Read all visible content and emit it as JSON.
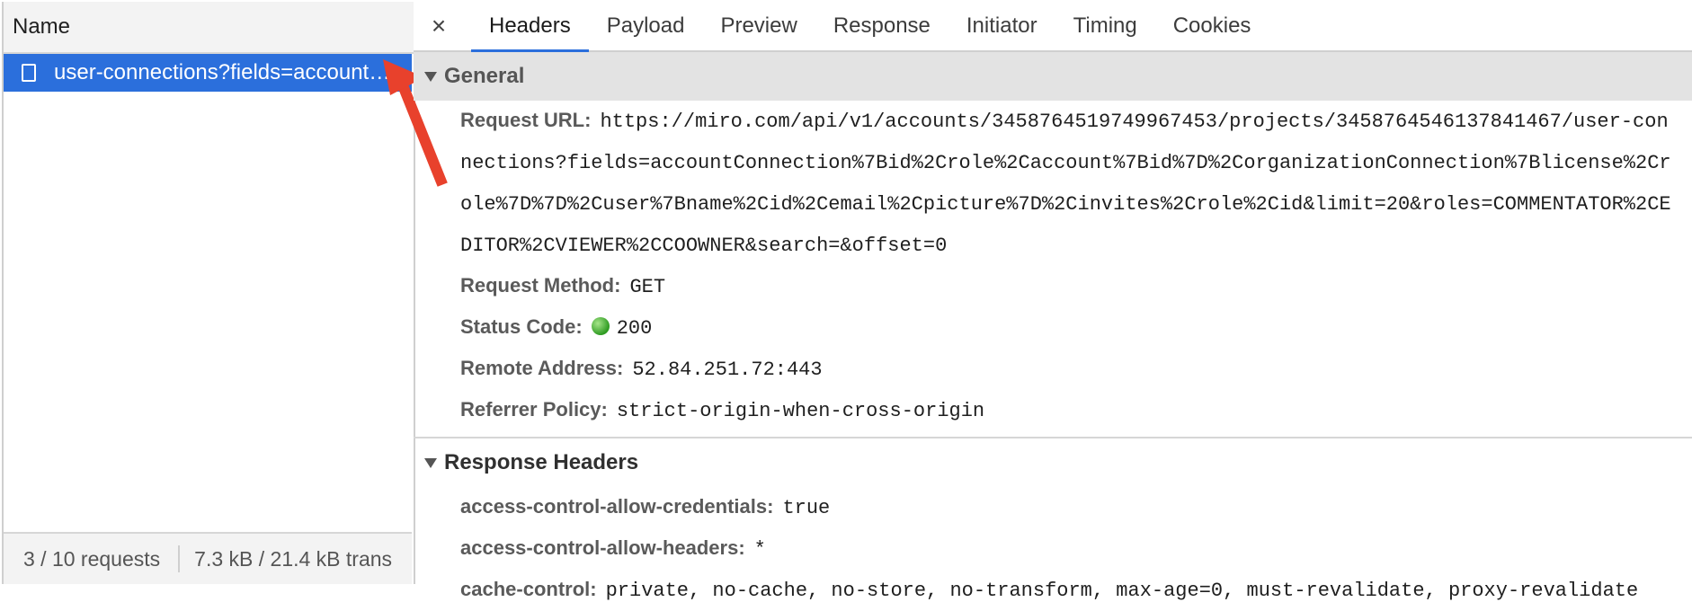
{
  "left": {
    "column_header": "Name",
    "selected_request": "user-connections?fields=account…",
    "status": {
      "requests": "3 / 10 requests",
      "transferred": "7.3 kB / 21.4 kB trans"
    }
  },
  "tabs": {
    "close": "×",
    "items": [
      "Headers",
      "Payload",
      "Preview",
      "Response",
      "Initiator",
      "Timing",
      "Cookies"
    ],
    "active": "Headers"
  },
  "general": {
    "title": "General",
    "request_url_label": "Request URL:",
    "request_url": "https://miro.com/api/v1/accounts/3458764519749967453/projects/3458764546137841467/user-connections?fields=accountConnection%7Bid%2Crole%2Caccount%7Bid%7D%2CorganizationConnection%7Blicense%2Crole%7D%7D%2Cuser%7Bname%2Cid%2Cemail%2Cpicture%7D%2Cinvites%2Crole%2Cid&limit=20&roles=COMMENTATOR%2CEDITOR%2CVIEWER%2CCOOWNER&search=&offset=0",
    "request_method_label": "Request Method:",
    "request_method": "GET",
    "status_code_label": "Status Code:",
    "status_code": "200",
    "remote_address_label": "Remote Address:",
    "remote_address": "52.84.251.72:443",
    "referrer_policy_label": "Referrer Policy:",
    "referrer_policy": "strict-origin-when-cross-origin"
  },
  "response_headers": {
    "title": "Response Headers",
    "items": [
      {
        "key": "access-control-allow-credentials:",
        "value": "true"
      },
      {
        "key": "access-control-allow-headers:",
        "value": "*"
      },
      {
        "key": "cache-control:",
        "value": "private, no-cache, no-store, no-transform, max-age=0, must-revalidate, proxy-revalidate"
      }
    ]
  },
  "colors": {
    "selection": "#2b6fdc",
    "annotation_arrow": "#e8412c",
    "status_ok": "#2e9b21"
  }
}
